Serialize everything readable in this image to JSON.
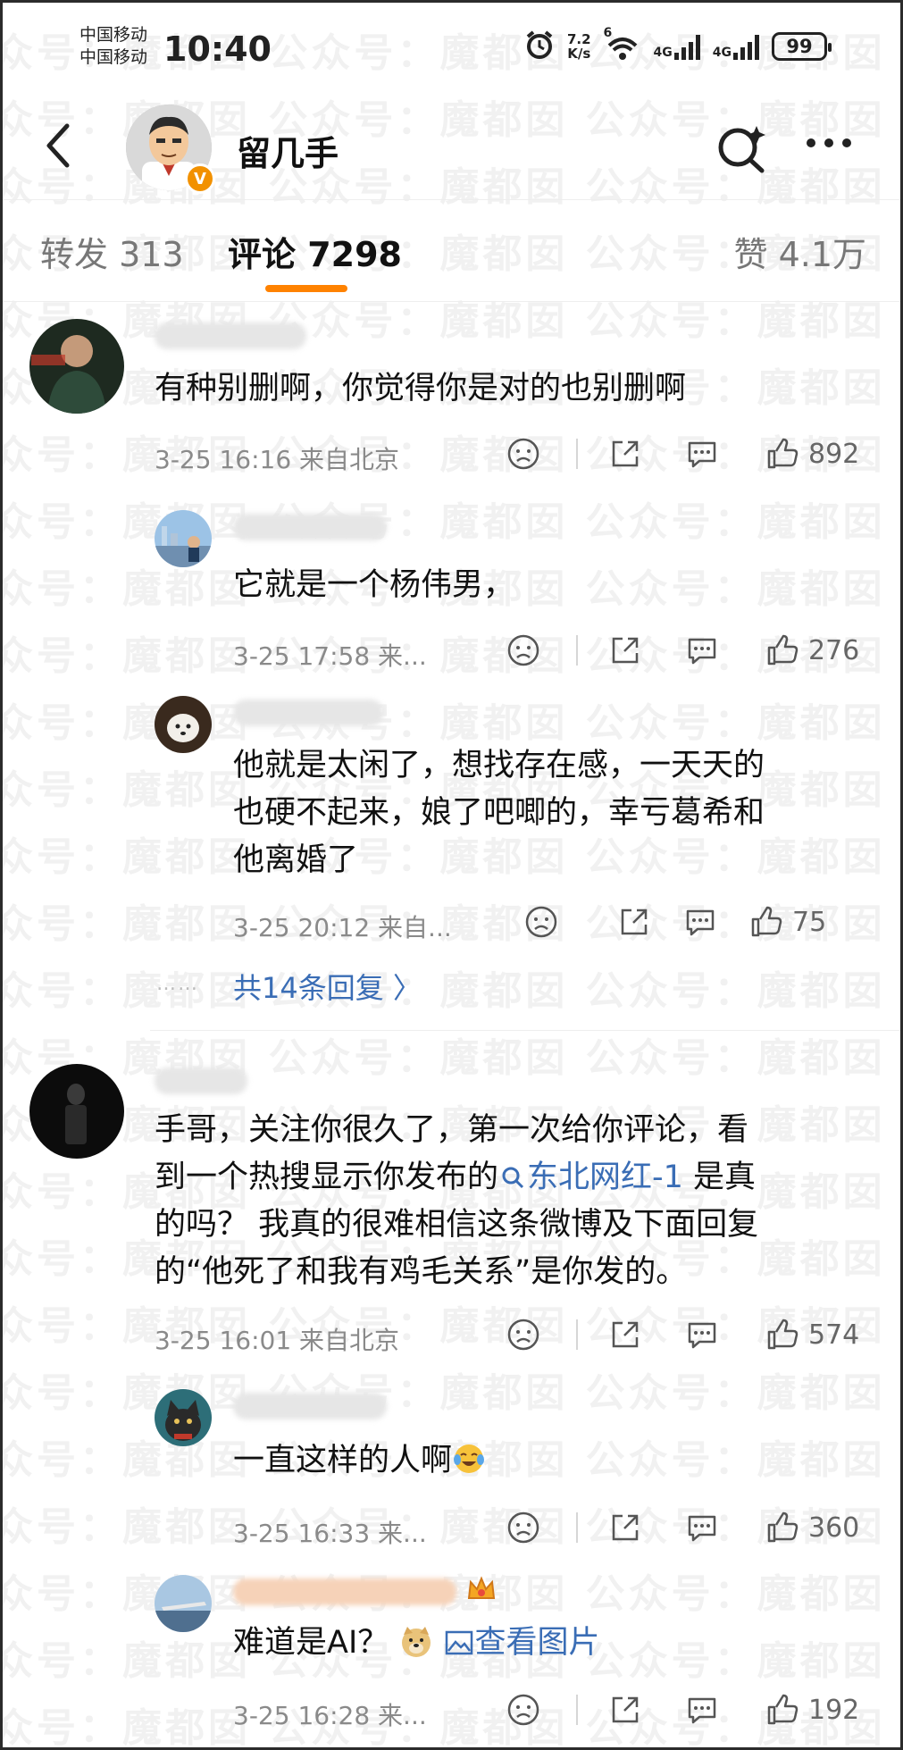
{
  "status_bar": {
    "carrier1": "中国移动",
    "carrier2": "中国移动",
    "time": "10:40",
    "net_speed_value": "7.2",
    "net_speed_unit": "K/s",
    "wifi_label": "6",
    "signal1_label": "4G",
    "signal2_label": "4G",
    "battery": "99"
  },
  "header": {
    "username": "留几手",
    "verified_badge": "V"
  },
  "tabs": {
    "repost": "转发 313",
    "comments": "评论 7298",
    "likes": "赞 4.1万",
    "active_color": "#ff8200"
  },
  "comments": [
    {
      "text": "有种别删啊，你觉得你是对的也别删啊",
      "meta": "3-25 16:16  来自北京",
      "likes": "892",
      "replies": [
        {
          "text": "它就是一个杨伟男，",
          "meta": "3-25 17:58  来...",
          "likes": "276"
        },
        {
          "text_lines": [
            "他就是太闲了，想找存在感，一天天的",
            "也硬不起来，娘了吧唧的，幸亏葛希和",
            "他离婚了"
          ],
          "meta": "3-25 20:12  来自...",
          "likes": "75"
        }
      ],
      "more_replies_dots": "……",
      "more_replies": "共14条回复 〉"
    },
    {
      "text_line1": "手哥，关注你很久了，第一次给你评论，看",
      "text_line2_prefix": "到一个热搜显示你发布的",
      "text_line2_link": "东北网红-1",
      "text_line2_suffix": " 是真",
      "text_line3": "的吗？ 我真的很难相信这条微博及下面回复",
      "text_line4": "的“他死了和我有鸡毛关系”是你发的。",
      "meta": "3-25 16:01  来自北京",
      "likes": "574",
      "replies": [
        {
          "text": "一直这样的人啊",
          "meta": "3-25 16:33  来...",
          "likes": "360"
        },
        {
          "text_prefix": "难道是AI？",
          "text_link": "查看图片",
          "meta": "3-25 16:28  来...",
          "likes": "192"
        }
      ]
    }
  ],
  "watermark": "众号：魔都囡 公众号：魔都囡 公众号：魔都囡 公众号：魔都囡"
}
